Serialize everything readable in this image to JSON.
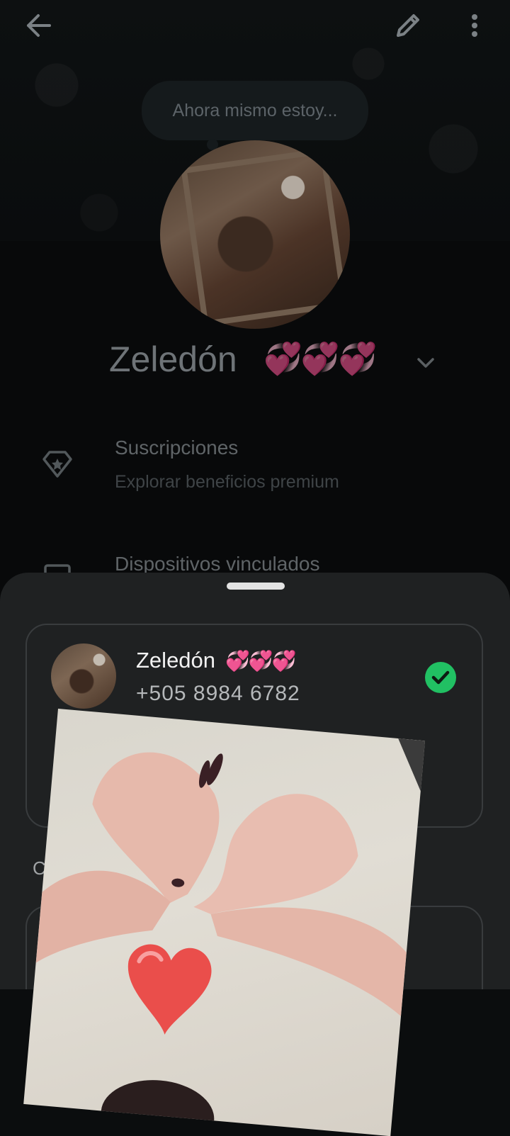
{
  "header": {
    "status_placeholder": "Ahora mismo estoy..."
  },
  "profile": {
    "name": "Zeledón",
    "name_emoji": "💞💞💞"
  },
  "menu": [
    {
      "title": "Suscripciones",
      "subtitle": "Explorar beneficios premium",
      "icon": "premium-diamond-icon"
    },
    {
      "title": "Dispositivos vinculados",
      "subtitle": "",
      "icon": "linked-devices-icon"
    }
  ],
  "account_sheet": {
    "account": {
      "name": "Zeledón",
      "name_emoji": "💞💞💞",
      "phone": "+505 8984 6782",
      "selected": true
    },
    "partial_text": "C"
  },
  "colors": {
    "check_green": "#21c063",
    "sheet_bg": "#1f2122",
    "page_bg": "#0b0d0e"
  }
}
